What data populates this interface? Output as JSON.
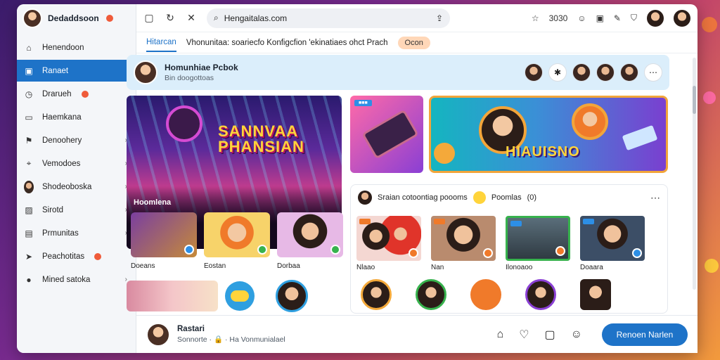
{
  "app": {
    "title": "Dedaddsoon"
  },
  "sidebar": {
    "items": [
      {
        "label": "Henendoon",
        "icon": "home-icon"
      },
      {
        "label": "Ranaet",
        "icon": "inbox-icon",
        "active": true
      },
      {
        "label": "Drarueh",
        "icon": "clock-icon",
        "badge": true
      },
      {
        "label": "Haemkana",
        "icon": "chat-icon"
      },
      {
        "label": "Denoohery",
        "icon": "flag-icon",
        "chevron": true
      },
      {
        "label": "Vemodoes",
        "icon": "pin-icon",
        "chevron": true
      },
      {
        "label": "Shodeoboska",
        "icon": "avatar",
        "chevron": true
      },
      {
        "label": "Sirotd",
        "icon": "image-icon",
        "chevron": true
      },
      {
        "label": "Prmunitas",
        "icon": "calendar-icon",
        "chevron": true
      },
      {
        "label": "Peachotitas",
        "icon": "send-icon",
        "badge": true
      },
      {
        "label": "Mined satoka",
        "icon": "person-icon",
        "chevron": true
      }
    ]
  },
  "topbar": {
    "url": "Hengaitalas.com",
    "time": "3030"
  },
  "tabs": {
    "active": "Hitarcan",
    "text": "Vhonunitaa: soariecfo Konfigcfion 'ekinatiaes ohct Prach",
    "pill": "Ocon"
  },
  "community": {
    "title": "Homunhiae Pcbok",
    "subtitle": "Bin doogottoas"
  },
  "hero": {
    "title_line1": "SANNVAA",
    "title_line2": "PHANSIAN",
    "label": "Hoomlena"
  },
  "thumbs": {
    "captions": [
      "Doeans",
      "Eostan",
      "Dorbaa"
    ]
  },
  "promo": {
    "title": "HIAUISNO"
  },
  "feed": {
    "title": "Sraian cotoontiag poooms",
    "badge_text": "Poomlas",
    "badge_suffix": "(0)",
    "captions": [
      "Nlaao",
      "Nan",
      "Ilonoaoo",
      "Doaara"
    ]
  },
  "footer": {
    "name": "Rastari",
    "sub_prefix": "Sonnorte",
    "sub_suffix": "Ha Vonmunialael",
    "button": "Renoen Narlen"
  },
  "colors": {
    "accent": "#1e73c8",
    "badge": "#ef5b3a",
    "pill_bg": "#ffd7b8",
    "community_bg": "#dbeefb"
  }
}
